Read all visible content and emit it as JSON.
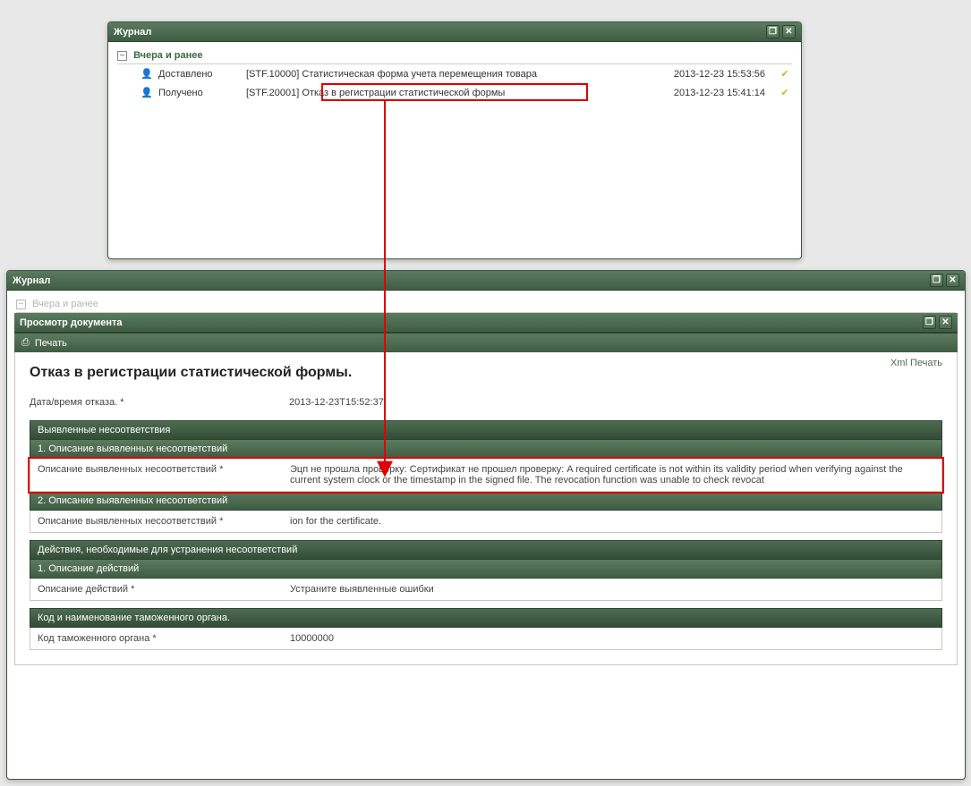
{
  "win1": {
    "title": "Журнал",
    "group": "Вчера и ранее",
    "rows": [
      {
        "status": "Доставлено",
        "subject": "[STF.10000] Статистическая форма учета перемещения товара",
        "dt": "2013-12-23 15:53:56"
      },
      {
        "status": "Получено",
        "subject": "[STF.20001] Отказ в регистрации статистической формы",
        "dt": "2013-12-23 15:41:14"
      }
    ]
  },
  "win2": {
    "title": "Журнал",
    "group": "Вчера и ранее",
    "doc_title": "Просмотр документа",
    "print": "Печать",
    "xml_print": "Xml Печать",
    "heading": "Отказ в регистрации статистической формы.",
    "date_label": "Дата/время отказа. *",
    "date_value": "2013-12-23T15:52:37",
    "sec1_title": "Выявленные несоответствия",
    "sec1_sub1": "1. Описание выявленных несоответствий",
    "sec1_row1_label": "Описание выявленных несоответствий *",
    "sec1_row1_value": "Эцп не прошла проверку: Сертификат не прошел проверку: A required certificate is not within its validity period when verifying against the current system clock or the timestamp in the signed file. The revocation function was unable to check revocat",
    "sec1_sub2": "2. Описание выявленных несоответствий",
    "sec1_row2_label": "Описание выявленных несоответствий *",
    "sec1_row2_value": "ion for the certificate.",
    "sec2_title": "Действия, необходимые для устранения несоответствий",
    "sec2_sub1": "1. Описание действий",
    "sec2_row1_label": "Описание действий *",
    "sec2_row1_value": "Устраните выявленные ошибки",
    "sec3_title": "Код и наименование таможенного органа.",
    "sec3_row1_label": "Код таможенного органа *",
    "sec3_row1_value": "10000000"
  },
  "glyph": {
    "minus": "−",
    "restore": "❐",
    "close": "✕",
    "user": "👤",
    "check": "✔",
    "print": "⎙"
  }
}
